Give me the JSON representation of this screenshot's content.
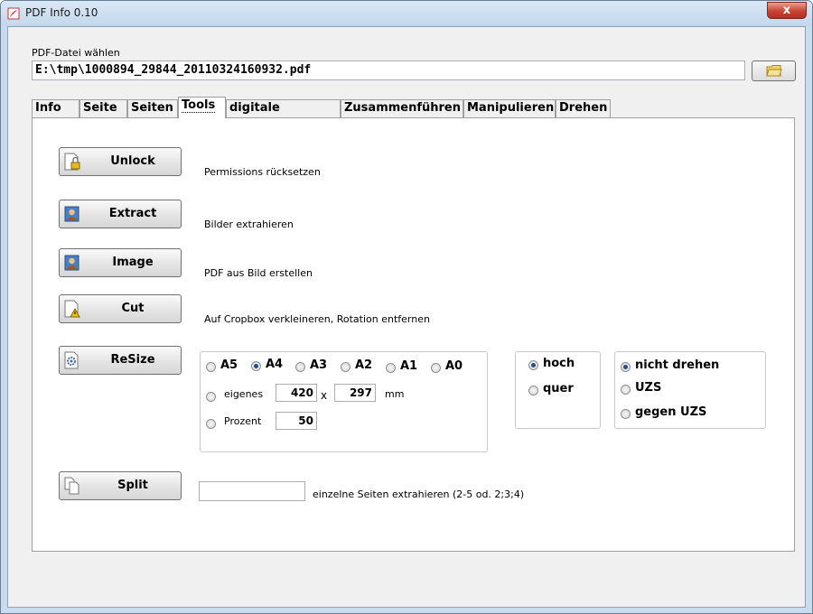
{
  "window": {
    "title": "PDF Info 0.10",
    "close_label": "x"
  },
  "file": {
    "label": "PDF-Datei wählen",
    "path": "E:\\tmp\\1000894_29844_20110324160932.pdf"
  },
  "tabs": [
    "Info",
    "Seite",
    "Seiten",
    "Tools",
    "digitale Signatur",
    "Zusammenführen",
    "Manipulieren",
    "Drehen"
  ],
  "active_tab": "Tools",
  "tools": {
    "unlock": {
      "label": "Unlock",
      "desc": "Permissions rücksetzen",
      "icon": "lock-doc-icon"
    },
    "extract": {
      "label": "Extract",
      "desc": "Bilder extrahieren",
      "icon": "portrait-icon"
    },
    "image": {
      "label": "Image",
      "desc": "PDF aus Bild erstellen",
      "icon": "portrait-icon"
    },
    "cut": {
      "label": "Cut",
      "desc": "Auf Cropbox verkleineren, Rotation entfernen",
      "icon": "warning-doc-icon"
    },
    "resize": {
      "label": "ReSize",
      "icon": "gear-doc-icon"
    },
    "split": {
      "label": "Split",
      "desc": "einzelne Seiten extrahieren (2-5 od. 2;3;4)",
      "value": "",
      "icon": "copy-docs-icon"
    }
  },
  "resize": {
    "sizes": [
      {
        "label": "A5",
        "selected": false
      },
      {
        "label": "A4",
        "selected": true
      },
      {
        "label": "A3",
        "selected": false
      },
      {
        "label": "A2",
        "selected": false
      },
      {
        "label": "A1",
        "selected": false
      },
      {
        "label": "A0",
        "selected": false
      }
    ],
    "custom": {
      "label": "eigenes",
      "width": "420",
      "sep": "x",
      "height": "297",
      "unit": "mm",
      "selected": false
    },
    "percent": {
      "label": "Prozent",
      "value": "50",
      "selected": false
    },
    "orientation": [
      {
        "label": "hoch",
        "selected": true
      },
      {
        "label": "quer",
        "selected": false
      }
    ],
    "rotation": [
      {
        "label": "nicht drehen",
        "selected": true
      },
      {
        "label": "UZS",
        "selected": false
      },
      {
        "label": "gegen UZS",
        "selected": false
      }
    ]
  }
}
